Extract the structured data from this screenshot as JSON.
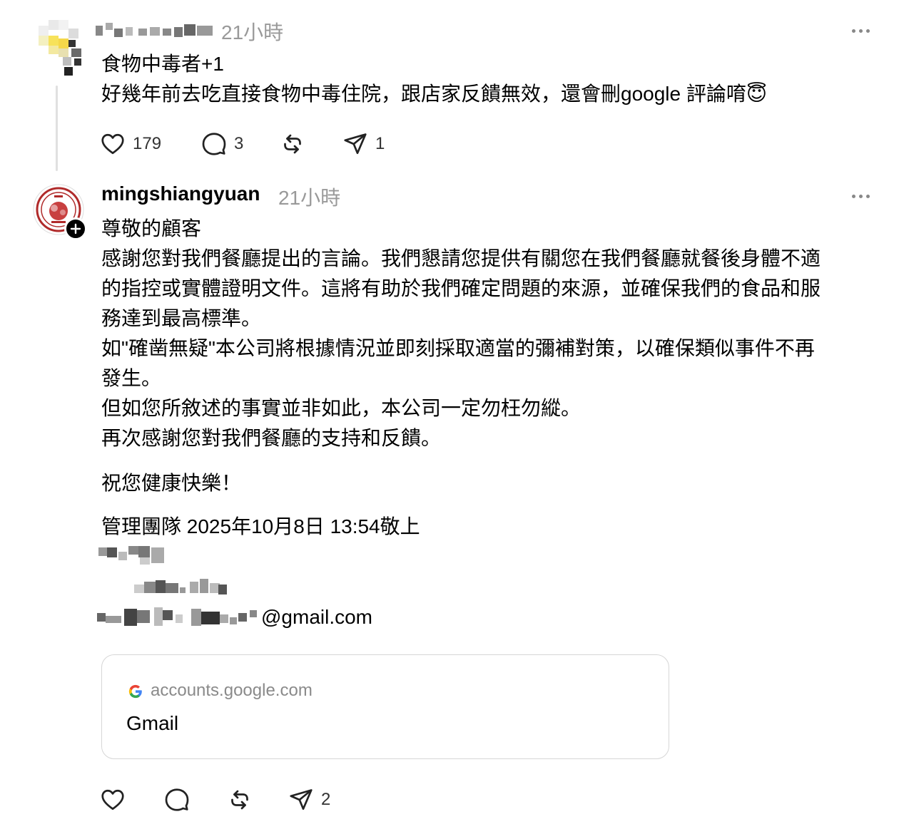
{
  "post1": {
    "username": "▘▝▖ ▗▞▟▆",
    "time": "21小時",
    "lines": [
      "食物中毒者+1",
      "好幾年前去吃直接食物中毒住院，跟店家反饋無效，還會刪google 評論唷😇"
    ],
    "likes": "179",
    "replies": "3",
    "shares": "1"
  },
  "post2": {
    "username": "mingshiangyuan",
    "time": "21小時",
    "lines": [
      "尊敬的顧客",
      "感謝您對我們餐廳提出的言論。我們懇請您提供有關您在我們餐廳就餐後身體不適",
      "的指控或實體證明文件。這將有助於我們確定問題的來源，並確保我們的食品和服",
      "務達到最高標準。",
      "如\"確凿無疑\"本公司將根據情況並即刻採取適當的彌補對策，以確保類似事件不再",
      "發生。",
      "但如您所敘述的事實並非如此，本公司一定勿枉勿縱。",
      "再次感謝您對我們餐廳的支持和反饋。"
    ],
    "closing": "祝您健康快樂！",
    "signature": "管理團隊 2025年10月8日 13:54敬上",
    "email_suffix": "@gmail.com",
    "shares": "2"
  },
  "link_card": {
    "domain": "accounts.google.com",
    "title": "Gmail"
  },
  "colors": {
    "timestamp": "#999999",
    "thread_line": "#e0e0e0",
    "card_border": "#d6d6d6",
    "seal_red": "#b02a2a"
  },
  "icons": [
    "heart-icon",
    "comment-icon",
    "repost-icon",
    "share-icon",
    "more-icon",
    "plus-icon",
    "google-g-icon"
  ]
}
